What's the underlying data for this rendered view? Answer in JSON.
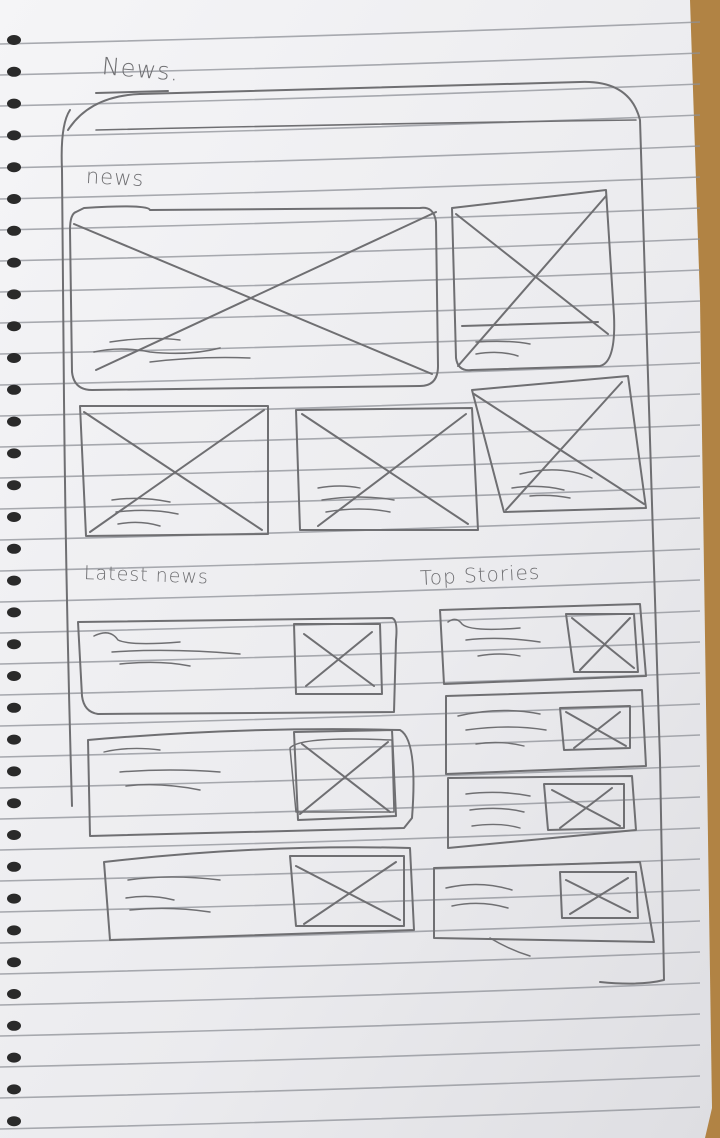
{
  "sketch": {
    "title": "News.",
    "section_label": "news",
    "latest_label": "Latest news",
    "top_label": "Top Stories"
  },
  "colors": {
    "paper": "#f1f1f3",
    "rule_line": "#8e9097",
    "pencil": "#6f6f72",
    "desk": "#b88a4a",
    "spiral": "#2a2a2a",
    "corner_tab": "#2a8fb3"
  }
}
